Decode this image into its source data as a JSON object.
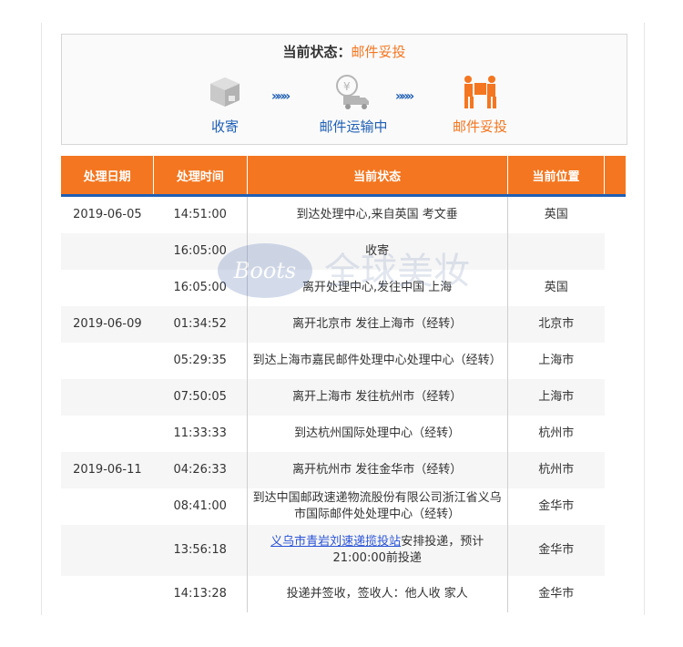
{
  "status": {
    "label": "当前状态：",
    "value": "邮件妥投",
    "steps": [
      {
        "label": "收寄",
        "icon": "package-icon"
      },
      {
        "label": "邮件运输中",
        "icon": "transport-truck-icon"
      },
      {
        "label": "邮件妥投",
        "icon": "delivery-person-icon"
      }
    ],
    "arrow": "»»»"
  },
  "table": {
    "headers": [
      "处理日期",
      "处理时间",
      "当前状态",
      "当前位置"
    ],
    "rows": [
      {
        "date": "2019-06-05",
        "time": "14:51:00",
        "status": "到达处理中心,来自英国 考文垂",
        "location": "英国"
      },
      {
        "date": "",
        "time": "16:05:00",
        "status": "收寄",
        "location": ""
      },
      {
        "date": "",
        "time": "16:05:00",
        "status": "离开处理中心,发往中国 上海",
        "location": "英国"
      },
      {
        "date": "2019-06-09",
        "time": "01:34:52",
        "status": "离开北京市 发往上海市（经转）",
        "location": "北京市"
      },
      {
        "date": "",
        "time": "05:29:35",
        "status": "到达上海市嘉民邮件处理中心处理中心（经转）",
        "location": "上海市"
      },
      {
        "date": "",
        "time": "07:50:05",
        "status": "离开上海市 发往杭州市（经转）",
        "location": "上海市"
      },
      {
        "date": "",
        "time": "11:33:33",
        "status": "到达杭州国际处理中心（经转）",
        "location": "杭州市"
      },
      {
        "date": "2019-06-11",
        "time": "04:26:33",
        "status": "离开杭州市 发往金华市（经转）",
        "location": "杭州市"
      },
      {
        "date": "",
        "time": "08:41:00",
        "status": "到达中国邮政速递物流股份有限公司浙江省义乌市国际邮件处处理中心（经转）",
        "location": "金华市"
      },
      {
        "date": "",
        "time": "13:56:18",
        "status_link": "义乌市青岩刘速递揽投站",
        "status": "安排投递，预计21:00:00前投递",
        "location": "金华市"
      },
      {
        "date": "",
        "time": "14:13:28",
        "status": "投递并签收，签收人：他人收 家人",
        "location": "金华市"
      }
    ]
  },
  "watermark": {
    "logo": "Boots",
    "text": "全球美妆"
  },
  "colors": {
    "accent": "#f47620",
    "blue": "#1f5fb4",
    "icon_gray": "#b5b5b5"
  }
}
